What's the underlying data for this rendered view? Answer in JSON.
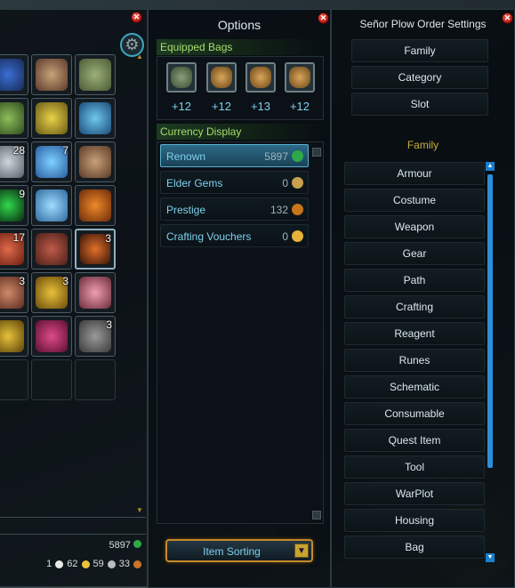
{
  "inventory": {
    "slots": [
      {
        "count": ""
      },
      {
        "count": ""
      },
      {
        "count": ""
      },
      {
        "count": ""
      },
      {
        "count": ""
      },
      {
        "count": ""
      },
      {
        "count": "28"
      },
      {
        "count": "7"
      },
      {
        "count": ""
      },
      {
        "count": "9"
      },
      {
        "count": ""
      },
      {
        "count": ""
      },
      {
        "count": "17"
      },
      {
        "count": ""
      },
      {
        "count": "3"
      },
      {
        "count": "3"
      },
      {
        "count": "3"
      },
      {
        "count": ""
      },
      {
        "count": ""
      },
      {
        "count": ""
      },
      {
        "count": "3"
      },
      {
        "count": ""
      },
      {
        "count": ""
      },
      {
        "count": ""
      }
    ],
    "renown": "5897",
    "currency": {
      "platinum": "1",
      "gold": "62",
      "silver": "59",
      "copper": "33"
    }
  },
  "options": {
    "title": "Options",
    "equipped_bags_label": "Equipped Bags",
    "bags": [
      "+12",
      "+12",
      "+13",
      "+12"
    ],
    "currency_display_label": "Currency Display",
    "currencies": [
      {
        "label": "Renown",
        "value": "5897"
      },
      {
        "label": "Elder Gems",
        "value": "0"
      },
      {
        "label": "Prestige",
        "value": "132"
      },
      {
        "label": "Crafting Vouchers",
        "value": "0"
      }
    ],
    "item_sorting_label": "Item Sorting"
  },
  "sort_settings": {
    "title": "Señor Plow Order Settings",
    "buttons": [
      "Family",
      "Category",
      "Slot"
    ],
    "family_header": "Family",
    "family_items": [
      "Armour",
      "Costume",
      "Weapon",
      "Gear",
      "Path",
      "Crafting",
      "Reagent",
      "Runes",
      "Schematic",
      "Consumable",
      "Quest Item",
      "Tool",
      "WarPlot",
      "Housing",
      "Bag"
    ]
  }
}
